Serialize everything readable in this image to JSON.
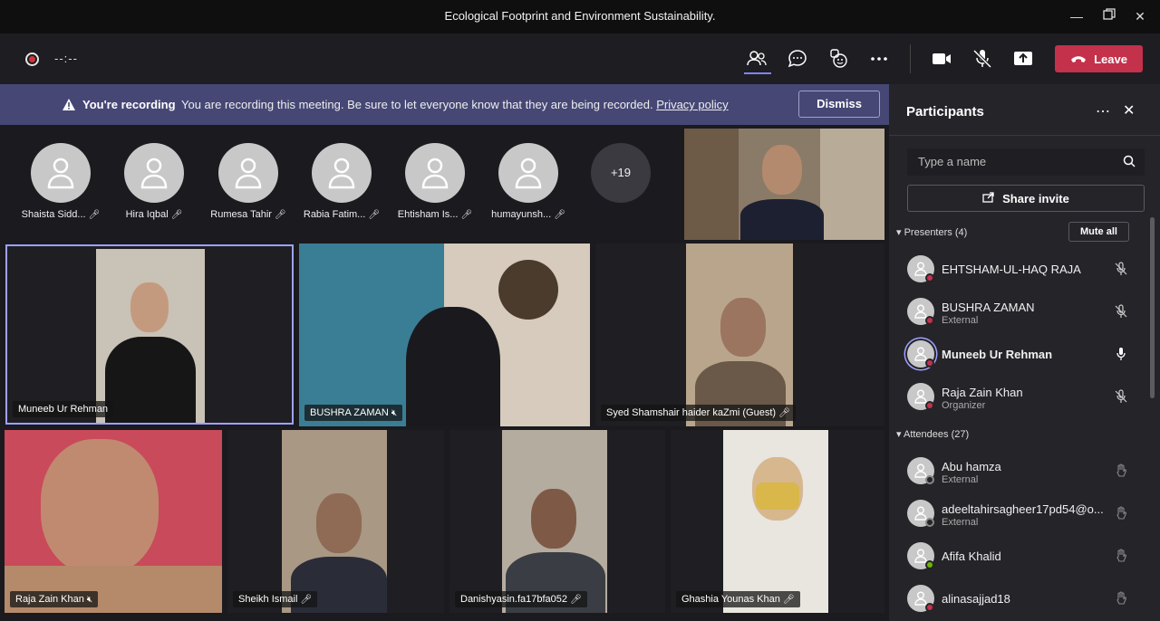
{
  "window": {
    "title": "Ecological Footprint and Environment Sustainability."
  },
  "toolbar": {
    "timer": "--:--",
    "leave_label": "Leave"
  },
  "banner": {
    "title": "You're recording",
    "text": "You are recording this meeting. Be sure to let everyone know that they are being recorded.",
    "link": "Privacy policy",
    "dismiss": "Dismiss"
  },
  "avatars": [
    {
      "name": "Shaista Sidd..."
    },
    {
      "name": "Hira Iqbal"
    },
    {
      "name": "Rumesa Tahir"
    },
    {
      "name": "Rabia Fatim..."
    },
    {
      "name": "Ehtisham Is..."
    },
    {
      "name": "humayunsh..."
    }
  ],
  "overflow_count": "+19",
  "video_tiles": [
    {
      "name": "Muneeb Ur Rehman"
    },
    {
      "name": "BUSHRA ZAMAN"
    },
    {
      "name": "Syed Shamshair haider kaZmi (Guest)"
    },
    {
      "name": "Raja Zain Khan"
    },
    {
      "name": "Sheikh Ismail"
    },
    {
      "name": "Danishyasin.fa17bfa052"
    },
    {
      "name": "Ghashia Younas Khan"
    }
  ],
  "panel": {
    "title": "Participants",
    "search_placeholder": "Type a name",
    "share_invite": "Share invite",
    "presenters_label": "Presenters (4)",
    "mute_all": "Mute all",
    "presenters": [
      {
        "name": "EHTSHAM-UL-HAQ RAJA",
        "sub": ""
      },
      {
        "name": "BUSHRA ZAMAN",
        "sub": "External"
      },
      {
        "name": "Muneeb Ur Rehman",
        "sub": ""
      },
      {
        "name": "Raja Zain Khan",
        "sub": "Organizer"
      }
    ],
    "attendees_label": "Attendees (27)",
    "attendees": [
      {
        "name": "Abu hamza",
        "sub": "External"
      },
      {
        "name": "adeeltahirsagheer17pd54@o...",
        "sub": "External"
      },
      {
        "name": "Afifa Khalid",
        "sub": ""
      },
      {
        "name": "alinasajjad18",
        "sub": ""
      }
    ]
  },
  "colors": {
    "accent": "#7f85f5",
    "leave": "#c4314b",
    "banner": "#464775",
    "busy": "#c4314b",
    "available": "#6bb700"
  }
}
